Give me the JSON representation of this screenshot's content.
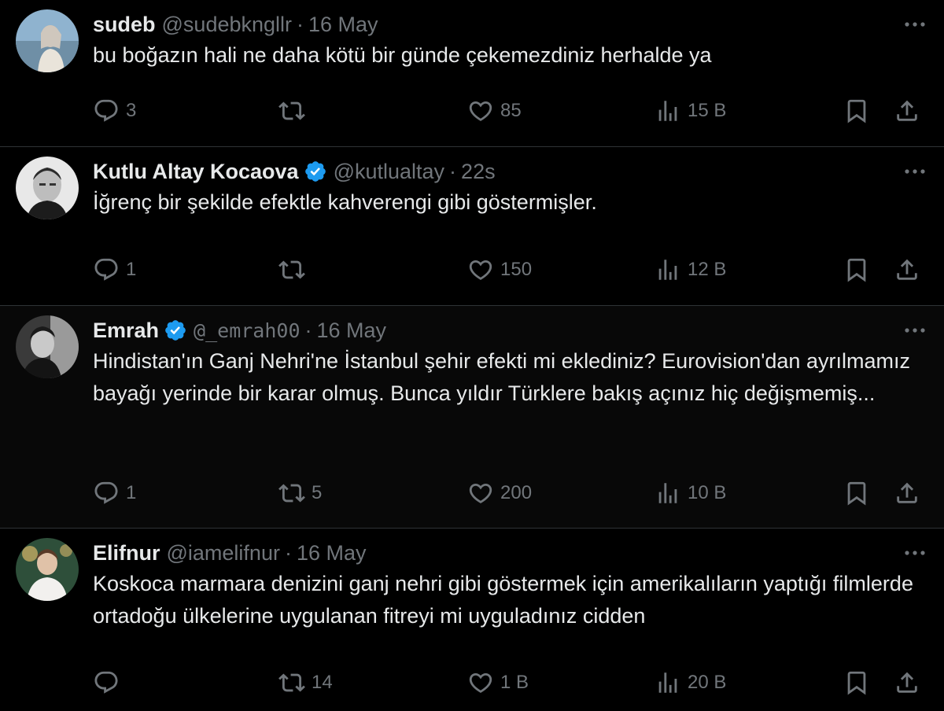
{
  "colors": {
    "background": "#000000",
    "text_primary": "#e7e9ea",
    "text_secondary": "#71767b",
    "divider": "#2f3336",
    "verified_badge": "#1d9bf0"
  },
  "tweets": [
    {
      "name": "sudeb",
      "verified": false,
      "handle": "@sudebkngllr",
      "separator": "·",
      "time": "16 May",
      "text": "bu boğazın hali ne daha kötü bir günde çekemezdiniz herhalde ya",
      "replies": "3",
      "retweets": "",
      "likes": "85",
      "views": "15 B",
      "avatar_icon": "avatar-photo"
    },
    {
      "name": "Kutlu Altay Kocaova",
      "verified": true,
      "handle": "@kutlualtay",
      "separator": "·",
      "time": "22s",
      "text": "İğrenç bir şekilde efektle kahverengi gibi göstermişler.",
      "replies": "1",
      "retweets": "",
      "likes": "150",
      "views": "12 B",
      "avatar_icon": "avatar-photo"
    },
    {
      "name": "Emrah",
      "verified": true,
      "handle": "@_emrah00",
      "separator": "·",
      "time": "16 May",
      "text": "Hindistan'ın Ganj Nehri'ne İstanbul şehir efekti mi eklediniz? Eurovision'dan ayrılmamız bayağı yerinde bir karar olmuş. Bunca yıldır Türklere bakış açınız hiç değişmemiş...",
      "replies": "1",
      "retweets": "5",
      "likes": "200",
      "views": "10 B",
      "avatar_icon": "avatar-photo"
    },
    {
      "name": "Elifnur",
      "verified": false,
      "handle": "@iamelifnur",
      "separator": "·",
      "time": "16 May",
      "text": "Koskoca marmara denizini ganj nehri gibi göstermek için amerikalıların yaptığı filmlerde ortadoğu ülkelerine uygulanan fitreyi mi uyguladınız cidden",
      "replies": "",
      "retweets": "14",
      "likes": "1 B",
      "views": "20 B",
      "avatar_icon": "avatar-photo"
    }
  ]
}
